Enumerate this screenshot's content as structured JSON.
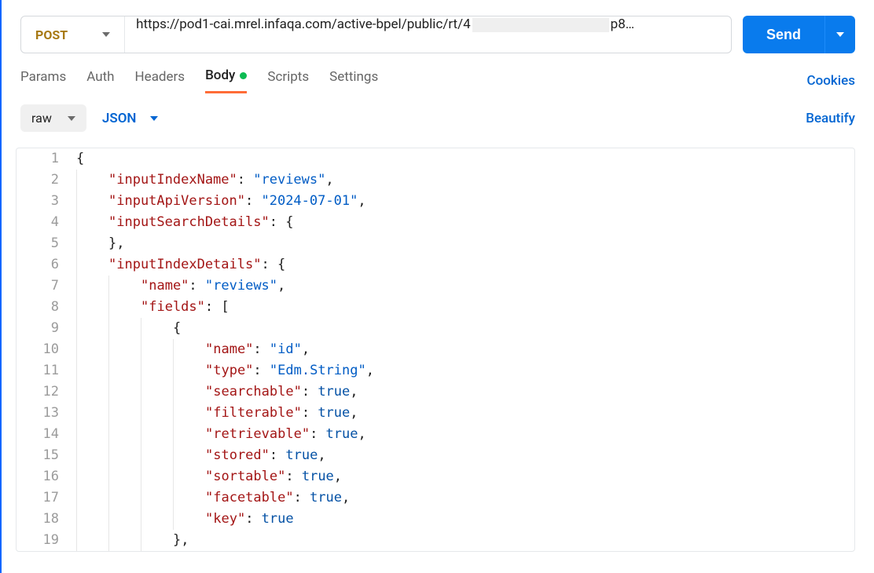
{
  "request": {
    "method": "POST",
    "url_prefix": "https://pod1-cai.mrel.infaqa.com/active-bpel/public/rt/4",
    "url_suffix": "p8…",
    "send_label": "Send"
  },
  "tabs": {
    "params": "Params",
    "auth": "Auth",
    "headers": "Headers",
    "body": "Body",
    "scripts": "Scripts",
    "settings": "Settings"
  },
  "cookies_label": "Cookies",
  "body_options": {
    "mode": "raw",
    "content_type": "JSON",
    "beautify": "Beautify"
  },
  "code": {
    "l1_a": "{",
    "l2_k": "\"inputIndexName\"",
    "l2_v": "\"reviews\"",
    "l3_k": "\"inputApiVersion\"",
    "l3_v": "\"2024-07-01\"",
    "l4_k": "\"inputSearchDetails\"",
    "l4_v": "{",
    "l5_a": "},",
    "l6_k": "\"inputIndexDetails\"",
    "l6_v": "{",
    "l7_k": "\"name\"",
    "l7_v": "\"reviews\"",
    "l8_k": "\"fields\"",
    "l8_v": "[",
    "l9_a": "{",
    "l10_k": "\"name\"",
    "l10_v": "\"id\"",
    "l11_k": "\"type\"",
    "l11_v": "\"Edm.String\"",
    "l12_k": "\"searchable\"",
    "l12_v": "true",
    "l13_k": "\"filterable\"",
    "l13_v": "true",
    "l14_k": "\"retrievable\"",
    "l14_v": "true",
    "l15_k": "\"stored\"",
    "l15_v": "true",
    "l16_k": "\"sortable\"",
    "l16_v": "true",
    "l17_k": "\"facetable\"",
    "l17_v": "true",
    "l18_k": "\"key\"",
    "l18_v": "true",
    "l19_a": "},"
  }
}
